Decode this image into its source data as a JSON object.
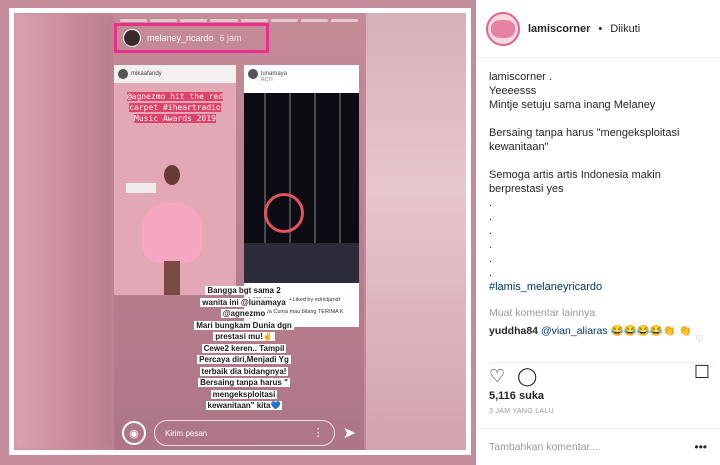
{
  "story": {
    "username": "melaney_ricardo",
    "time": "6 jam",
    "left_card": {
      "user": "mikaafandy",
      "text": "@agnezmo hit the red carpet #iheartradio Music Awards 2019"
    },
    "right_card": {
      "user": "lunamaya",
      "sub": "RCTI",
      "views": "1.131.030 views • Liked by edrictjandr",
      "caption": "lunamaya Cuma mau bilang TERIMA K"
    },
    "text_lines": [
      "Bangga bgt sama 2",
      "wanita ini @lunamaya",
      "@agnezmo",
      "Mari bungkam Dunia dgn",
      "prestasi mu!✌",
      "Cewe2 keren.. Tampil",
      "Percaya diri,Menjadi Yg",
      "terbaik dia bidangnya!",
      "Bersaing tanpa harus \"",
      "mengeksploitasi",
      "kewanitaan\" kita💙"
    ],
    "message_placeholder": "Kirim pesan",
    "camera_icon": "camera-icon",
    "send_icon": "send-icon"
  },
  "panel": {
    "username": "lamiscorner",
    "dot": "•",
    "follow": "Diikuti",
    "caption_lines": [
      "lamiscorner .",
      "Yeeeesss",
      "Mintje setuju sama inang Melaney",
      "",
      "Bersaing tanpa harus \"mengeksploitasi",
      "kewanitaan\"",
      "",
      "Semoga artis artis Indonesia makin",
      "berprestasi yes",
      ".",
      ".",
      ".",
      ".",
      ".",
      "."
    ],
    "hashtag": "#lamis_melaneyricardo",
    "more_comments": "Muat komentar lainnya",
    "comment": {
      "user": "yuddha84",
      "mention": "@vian_aliaras",
      "emojis": "😂😂😂😂👏 👏"
    },
    "likes": "5,116 suka",
    "when": "3 JAM YANG LALU",
    "add_comment": "Tambahkan komentar...",
    "more_dots": "•••"
  },
  "colors": {
    "highlight": "#e8308a",
    "background": "#c48c9a"
  }
}
